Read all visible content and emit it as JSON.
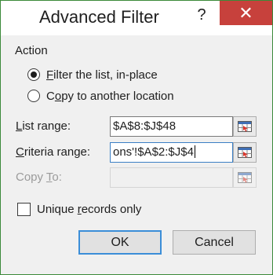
{
  "window": {
    "title": "Advanced Filter",
    "help_glyph": "?",
    "close_glyph": "✕"
  },
  "action": {
    "label": "Action",
    "filter_in_place": {
      "accel": "F",
      "rest": "ilter the list, in-place",
      "checked": true
    },
    "copy_to_location": {
      "accel": "o",
      "pre": "C",
      "rest": "py to another location",
      "checked": false
    }
  },
  "list_range": {
    "accel": "L",
    "rest": "ist range:",
    "value": "$A$8:$J$48"
  },
  "criteria_range": {
    "accel": "C",
    "rest": "riteria range:",
    "value": "ons'!$A$2:$J$4"
  },
  "copy_to": {
    "accel": "T",
    "pre": "Copy ",
    "rest": "o:",
    "value": ""
  },
  "unique_records": {
    "pre": "Unique ",
    "accel": "r",
    "rest": "ecords only",
    "checked": false
  },
  "buttons": {
    "ok": "OK",
    "cancel": "Cancel"
  },
  "colors": {
    "close": "#c7413c",
    "focus": "#3b7fc4",
    "border": "#3c8a3a"
  },
  "icons": {
    "collapse": "range-selector-icon",
    "help": "help-icon",
    "close": "close-icon"
  }
}
